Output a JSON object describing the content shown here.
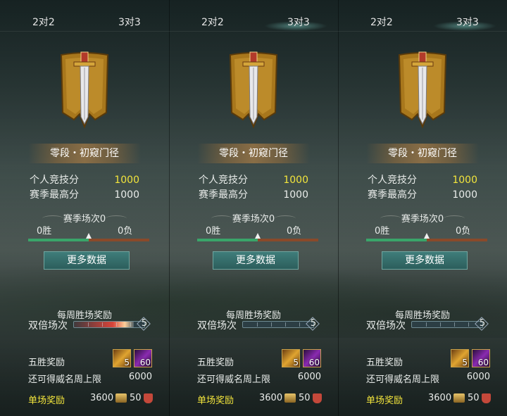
{
  "panels": [
    {
      "tabs": {
        "left": "2对2",
        "right": "3对3"
      },
      "rank_name": "零段・初窥门径",
      "stats": [
        {
          "label": "个人竞技分",
          "value": "1000"
        },
        {
          "label": "赛季最高分",
          "value": "1000"
        }
      ],
      "season": {
        "title": "赛季场次0",
        "wins": "0胜",
        "losses": "0负"
      },
      "more_button": "更多数据",
      "weekly": {
        "title": "每周胜场奖励",
        "double_label": "双倍场次",
        "double_count": "5"
      },
      "five_win": {
        "label": "五胜奖励",
        "item1_count": "5",
        "item2_count": "60"
      },
      "cap": {
        "label": "还可得威名周上限",
        "value": "6000"
      },
      "single": {
        "label": "单场奖励",
        "coin": "3600",
        "honor": "50"
      }
    },
    {
      "tabs": {
        "left": "2对2",
        "right": "3对3"
      },
      "rank_name": "零段・初窥门径",
      "stats": [
        {
          "label": "个人竞技分",
          "value": "1000"
        },
        {
          "label": "赛季最高分",
          "value": "1000"
        }
      ],
      "season": {
        "title": "赛季场次0",
        "wins": "0胜",
        "losses": "0负"
      },
      "more_button": "更多数据",
      "weekly": {
        "title": "每周胜场奖励",
        "double_label": "双倍场次",
        "double_count": "5"
      },
      "five_win": {
        "label": "五胜奖励",
        "item1_count": "5",
        "item2_count": "60"
      },
      "cap": {
        "label": "还可得威名周上限",
        "value": "6000"
      },
      "single": {
        "label": "单场奖励",
        "coin": "3600",
        "honor": "50"
      }
    },
    {
      "tabs": {
        "left": "2对2",
        "right": "3对3"
      },
      "rank_name": "零段・初窥门径",
      "stats": [
        {
          "label": "个人竞技分",
          "value": "1000"
        },
        {
          "label": "赛季最高分",
          "value": "1000"
        }
      ],
      "season": {
        "title": "赛季场次0",
        "wins": "0胜",
        "losses": "0负"
      },
      "more_button": "更多数据",
      "weekly": {
        "title": "每周胜场奖励",
        "double_label": "双倍场次",
        "double_count": "5"
      },
      "five_win": {
        "label": "五胜奖励",
        "item1_count": "5",
        "item2_count": "60"
      },
      "cap": {
        "label": "还可得威名周上限",
        "value": "6000"
      },
      "single": {
        "label": "单场奖励",
        "coin": "3600",
        "honor": "50"
      }
    }
  ],
  "icons": {
    "emblem": "sword-banner-emblem-icon",
    "item_gold": "gold-treasure-box-icon",
    "item_purple": "purple-gem-icon",
    "coin": "coin-icon",
    "honor": "red-shield-icon"
  },
  "colors": {
    "highlight": "#f3e53c",
    "win_bar": "#3aa56a",
    "loss_bar": "#8a4a2a",
    "button": "#2f6b68"
  },
  "wl_bar_marker_fraction": 0.5,
  "double_bar_fill_fraction": [
    0.85,
    0.0,
    0.0
  ]
}
